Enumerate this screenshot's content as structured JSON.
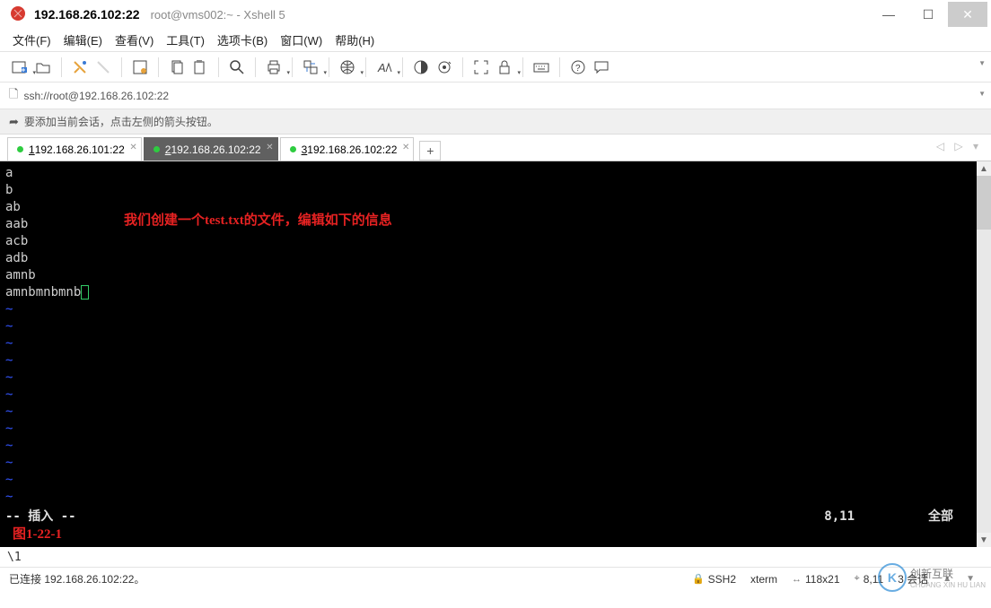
{
  "titlebar": {
    "main": "192.168.26.102:22",
    "sub": "root@vms002:~ - Xshell 5"
  },
  "menu": {
    "file": "文件(F)",
    "edit": "编辑(E)",
    "view": "查看(V)",
    "tools": "工具(T)",
    "tabs": "选项卡(B)",
    "window": "窗口(W)",
    "help": "帮助(H)"
  },
  "address": {
    "url": "ssh://root@192.168.26.102:22"
  },
  "hint": {
    "text": "要添加当前会话，点击左侧的箭头按钮。"
  },
  "tabs": [
    {
      "num": "1",
      "label": " 192.168.26.101:22"
    },
    {
      "num": "2",
      "label": " 192.168.26.102:22"
    },
    {
      "num": "3",
      "label": " 192.168.26.102:22"
    }
  ],
  "terminal": {
    "lines": [
      "a",
      "b",
      "ab",
      "aab",
      "acb",
      "adb",
      "amnb",
      "amnbmnbmnb"
    ],
    "annotation": "我们创建一个test.txt的文件，编辑如下的信息",
    "mode": "-- 插入 --",
    "position": "8,11",
    "scope": "全部",
    "figure_label": "图1-22-1"
  },
  "below": {
    "text": "\\1"
  },
  "status": {
    "connected": "已连接 192.168.26.102:22。",
    "proto": "SSH2",
    "term": "xterm",
    "size": "118x21",
    "cursor": "8,11",
    "sessions": "3 会话"
  },
  "watermark": {
    "brand": "创新互联",
    "sub": "CHUANG XIN HU LIAN"
  },
  "icons": {
    "minimize": "—",
    "maximize": "☐",
    "close": "✕",
    "lock": "🔒",
    "arrow_out": "➦",
    "plus": "+",
    "nav": "◁  ▷  ▾"
  }
}
